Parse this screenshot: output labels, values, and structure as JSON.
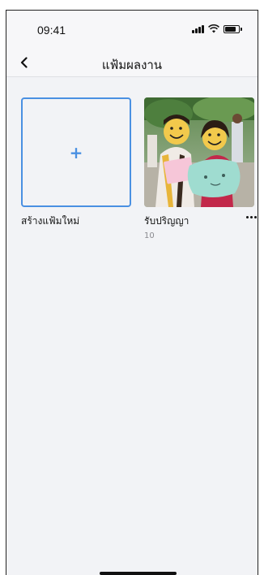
{
  "status_bar": {
    "time": "09:41",
    "icons": [
      "signal-icon",
      "wifi-icon",
      "battery-icon"
    ]
  },
  "nav": {
    "back_icon": "chevron-left-icon",
    "title": "แฟ้มผลงาน"
  },
  "albums": {
    "new_album": {
      "icon": "plus-icon",
      "plus_symbol": "+",
      "label": "สร้างแฟ้มใหม่"
    },
    "items": [
      {
        "name": "รับปริญญา",
        "count": "10",
        "cover": "graduation-photo",
        "menu_icon": "more-horizontal-icon"
      }
    ]
  },
  "colors": {
    "accent": "#4a90e2",
    "background": "#f2f3f6",
    "text": "#111111",
    "muted": "#8a8a8f"
  }
}
